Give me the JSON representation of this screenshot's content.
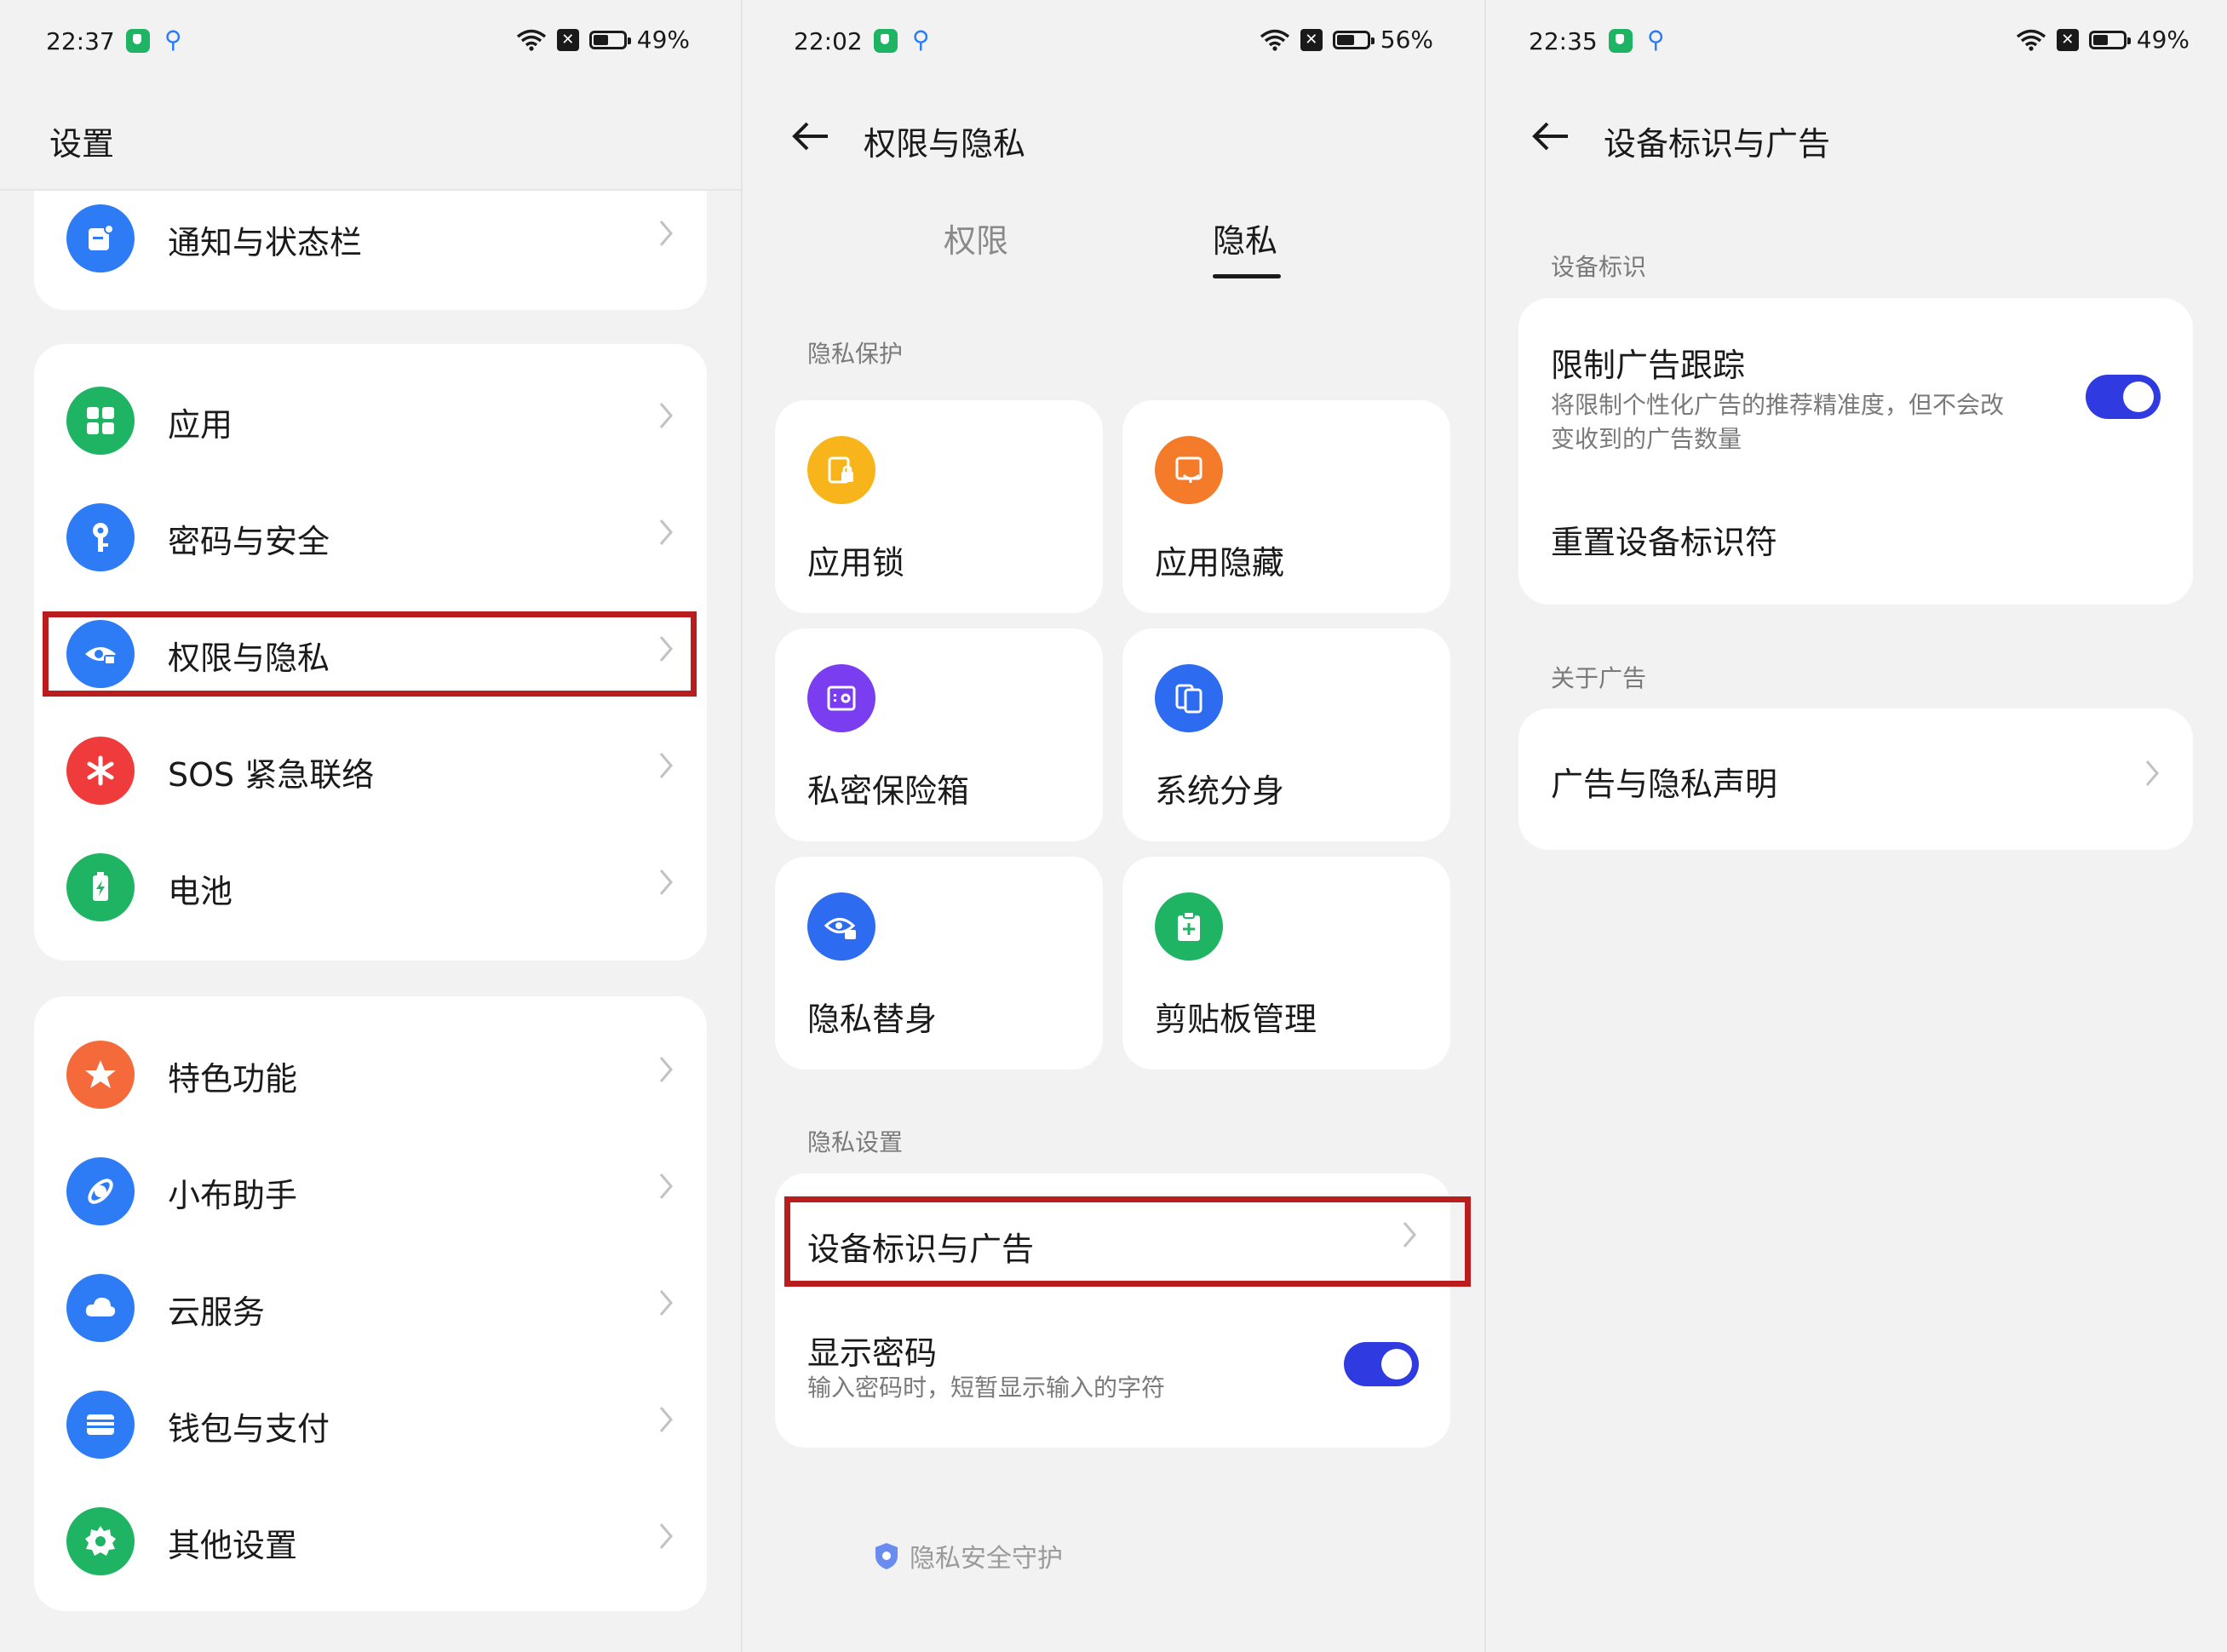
{
  "panel1": {
    "status": {
      "time": "22:37",
      "battery": "49%",
      "battery_level": 0.49
    },
    "title": "设置",
    "items": [
      {
        "label": "通知与状态栏",
        "icon": "notification-icon",
        "color": "#2d7cf6"
      },
      {
        "label": "应用",
        "icon": "apps-grid-icon",
        "color": "#1fb463"
      },
      {
        "label": "密码与安全",
        "icon": "key-icon",
        "color": "#2d7cf6"
      },
      {
        "label": "权限与隐私",
        "icon": "privacy-eye-icon",
        "color": "#2d7cf6"
      },
      {
        "label": "SOS 紧急联络",
        "icon": "sos-asterisk-icon",
        "color": "#ef3b3b"
      },
      {
        "label": "电池",
        "icon": "battery-icon",
        "color": "#1fb463"
      },
      {
        "label": "特色功能",
        "icon": "star-icon",
        "color": "#f46a3a"
      },
      {
        "label": "小布助手",
        "icon": "assistant-icon",
        "color": "#2d7cf6"
      },
      {
        "label": "云服务",
        "icon": "cloud-icon",
        "color": "#2d7cf6"
      },
      {
        "label": "钱包与支付",
        "icon": "wallet-icon",
        "color": "#2d7cf6"
      },
      {
        "label": "其他设置",
        "icon": "gear-icon",
        "color": "#1fb463"
      }
    ]
  },
  "panel2": {
    "status": {
      "time": "22:02",
      "battery": "56%",
      "battery_level": 0.56
    },
    "title": "权限与隐私",
    "tabs": [
      "权限",
      "隐私"
    ],
    "active_tab": "隐私",
    "section_protection": "隐私保护",
    "tiles": [
      {
        "label": "应用锁",
        "icon": "app-lock-icon",
        "color": "#f7b51b"
      },
      {
        "label": "应用隐藏",
        "icon": "app-hide-icon",
        "color": "#f47b2a"
      },
      {
        "label": "私密保险箱",
        "icon": "safe-box-icon",
        "color": "#7a3df0"
      },
      {
        "label": "系统分身",
        "icon": "clone-icon",
        "color": "#2d6bf0"
      },
      {
        "label": "隐私替身",
        "icon": "privacy-mask-icon",
        "color": "#2d6bf0"
      },
      {
        "label": "剪贴板管理",
        "icon": "clipboard-icon",
        "color": "#1fb463"
      }
    ],
    "section_settings": "隐私设置",
    "device_id_ads": "设备标识与广告",
    "show_password": {
      "title": "显示密码",
      "desc": "输入密码时，短暂显示输入的字符",
      "on": true
    },
    "footer": "隐私安全守护"
  },
  "panel3": {
    "status": {
      "time": "22:35",
      "battery": "49%",
      "battery_level": 0.49
    },
    "title": "设备标识与广告",
    "section_device_id": "设备标识",
    "limit_ad": {
      "title": "限制广告跟踪",
      "desc_line1": "将限制个性化广告的推荐精准度，但不会改",
      "desc_line2": "变收到的广告数量",
      "on": true
    },
    "reset_id": "重置设备标识符",
    "section_about": "关于广告",
    "ad_privacy": "广告与隐私声明"
  },
  "colors": {
    "accent": "#2f3be0",
    "highlight": "#b91d1d"
  }
}
